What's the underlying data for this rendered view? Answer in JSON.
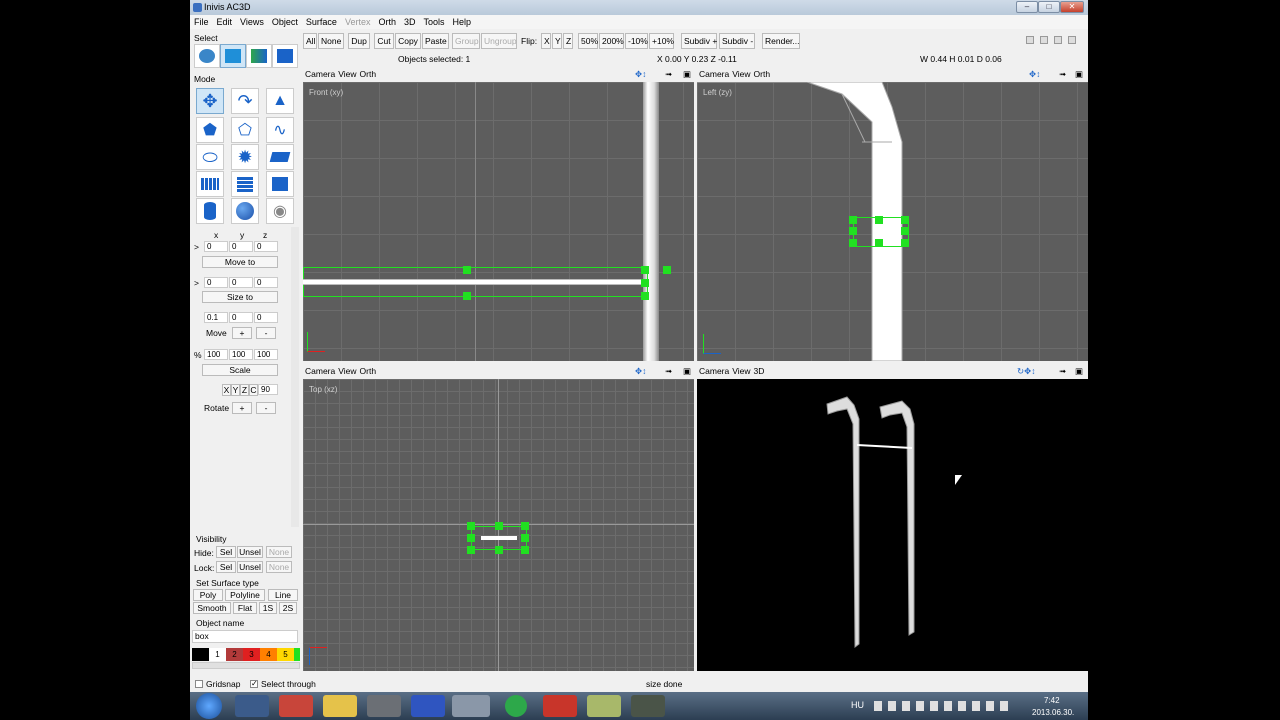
{
  "window": {
    "title": "Inivis AC3D"
  },
  "menu": [
    "File",
    "Edit",
    "Views",
    "Object",
    "Surface",
    "Vertex",
    "Orth",
    "3D",
    "Tools",
    "Help"
  ],
  "menu_disabled": [
    "Vertex"
  ],
  "toolbar": {
    "buttons": [
      "All",
      "None",
      "Dup",
      "Cut",
      "Copy",
      "Paste",
      "Group",
      "Ungroup"
    ],
    "flip_label": "Flip:",
    "flip": [
      "X",
      "Y",
      "Z"
    ],
    "zoom": [
      "50%",
      "200%",
      "-10%",
      "+10%"
    ],
    "subdiv_plus": "Subdiv +",
    "subdiv_minus": "Subdiv -",
    "render": "Render...",
    "objects_selected": "Objects selected: 1",
    "coords": "X 0.00 Y 0.23 Z -0.11",
    "dims": "W 0.44 H 0.01 D 0.06"
  },
  "left_panel": {
    "select_title": "Select",
    "mode_title": "Mode",
    "xyz": [
      "x",
      "y",
      "z"
    ],
    "row1": [
      "0",
      "0",
      "0"
    ],
    "move_to": "Move to",
    "row2": [
      "0",
      "0",
      "0"
    ],
    "size_to": "Size to",
    "row3": [
      "0.1",
      "0",
      "0"
    ],
    "move_label": "Move",
    "plus": "+",
    "minus": "-",
    "pct": "%",
    "arrow": ">",
    "row4": [
      "100",
      "100",
      "100"
    ],
    "scale": "Scale",
    "rot_axes": [
      "X",
      "Y",
      "Z",
      "C"
    ],
    "rot_value": "90",
    "rotate_label": "Rotate",
    "visibility_title": "Visibility",
    "hide_label": "Hide:",
    "lock_label": "Lock:",
    "sel": "Sel",
    "unsel": "Unsel",
    "none": "None",
    "surface_title": "Set Surface type",
    "surf_row1": [
      "Poly",
      "Polyline",
      "Line"
    ],
    "surf_row2": [
      "Smooth",
      "Flat",
      "1S",
      "2S"
    ],
    "object_name_title": "Object name",
    "object_name": "box",
    "colors": [
      "#000000",
      "#ffffff",
      "#b23a3a",
      "#e02020",
      "#ff8000",
      "#ffd800",
      "#21e021"
    ],
    "color_labels": [
      "1",
      "2",
      "3",
      "4",
      "5"
    ]
  },
  "viewports": {
    "front": {
      "menu": [
        "Camera",
        "View",
        "Orth"
      ],
      "name": "Front (xy)"
    },
    "left": {
      "menu": [
        "Camera",
        "View",
        "Orth"
      ],
      "name": "Left (zy)"
    },
    "top": {
      "menu": [
        "Camera",
        "View",
        "Orth"
      ],
      "name": "Top (xz)"
    },
    "persp": {
      "menu": [
        "Camera",
        "View",
        "3D"
      ]
    }
  },
  "status": {
    "gridsnap": "Gridsnap",
    "select_through": "Select through",
    "message": "size done"
  },
  "taskbar": {
    "lang": "HU",
    "time": "7:42",
    "date": "2013.06.30."
  },
  "colors": {
    "accent": "#1a63c8",
    "handle": "#21e021",
    "viewport_bg": "#5d5d5d"
  }
}
